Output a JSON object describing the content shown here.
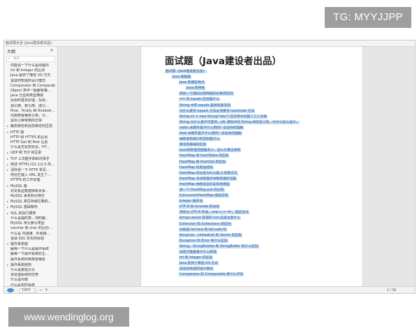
{
  "watermarks": {
    "top": "TG: MYYJJPP",
    "bottom": "www.wendinglog.org"
  },
  "window": {
    "title": "面试题大全 (Java建设者出品)"
  },
  "sidebar": {
    "title": "大纲",
    "add_icon": "plus-icon",
    "search_placeholder": "搜索",
    "items": [
      {
        "label": "你能说一下什么是线程吗",
        "arrow": ""
      },
      {
        "label": "int 和 Integer 的区别",
        "arrow": ""
      },
      {
        "label": "Java 提供了哪些 I/O 方式",
        "arrow": ""
      },
      {
        "label": "谈谈你知道的设计模式",
        "arrow": ""
      },
      {
        "label": "Comparator 和 Comparab",
        "arrow": ""
      },
      {
        "label": "Object 类中一般都有哪…",
        "arrow": ""
      },
      {
        "label": "Java 泛型和类型擦除",
        "arrow": ""
      },
      {
        "label": "反射的基本原理，反射…",
        "arrow": ""
      },
      {
        "label": "强引用、若引用、虚引…",
        "arrow": ""
      },
      {
        "label": "final、finally 和 finalize(…",
        "arrow": ""
      },
      {
        "label": "内部类有哪些分类，分…",
        "arrow": ""
      },
      {
        "label": "说出几种常用的异常",
        "arrow": ""
      },
      {
        "label": "静态绑定和动态绑定的区别",
        "arrow": "▸"
      },
      {
        "label": "HTTP 篇",
        "arrow": "▾"
      },
      {
        "label": "HTTP 和 HTTPS 的区别",
        "arrow": ""
      },
      {
        "label": "HTTP Get 和 Post 区别",
        "arrow": ""
      },
      {
        "label": "什么是无状态协议，HT…",
        "arrow": ""
      },
      {
        "label": "UDP 和 TCP 的区别",
        "arrow": "▸"
      },
      {
        "label": "TCP 三次握手和四次挥手",
        "arrow": "▸"
      },
      {
        "label": "简述 HTTP1.0/1.1/2.0 的…",
        "arrow": "▸"
      },
      {
        "label": "请你说一下 HTTP 常见…",
        "arrow": "▸"
      },
      {
        "label": "地址栏输入 URL 发生了…",
        "arrow": ""
      },
      {
        "label": "HTTPS 的工作原理",
        "arrow": ""
      },
      {
        "label": "MySQL 篇",
        "arrow": "▾"
      },
      {
        "label": "非关系型数据库和关系…",
        "arrow": ""
      },
      {
        "label": "MySQL 事务四大特性",
        "arrow": ""
      },
      {
        "label": "MySQL 常见存储引擎的…",
        "arrow": "▸"
      },
      {
        "label": "MySQL 基础架构",
        "arrow": "▸"
      },
      {
        "label": "SQL 的执行顺序",
        "arrow": "▸"
      },
      {
        "label": "什么是临时表，何时删…",
        "arrow": ""
      },
      {
        "label": "MySQL 常见索引类型",
        "arrow": ""
      },
      {
        "label": "varchar 和 char 的区别…",
        "arrow": ""
      },
      {
        "label": "什么是 内连接、外连接…",
        "arrow": ""
      },
      {
        "label": "谈谈 SQL 优化的经验",
        "arrow": ""
      },
      {
        "label": "操作系统篇",
        "arrow": "▾"
      },
      {
        "label": "解释一下什么是操作系统",
        "arrow": ""
      },
      {
        "label": "解释一下操作系统的主…",
        "arrow": ""
      },
      {
        "label": "操作系统的种类有哪些",
        "arrow": ""
      },
      {
        "label": "操作系统结构",
        "arrow": "▸"
      },
      {
        "label": "什么是按需分页",
        "arrow": ""
      },
      {
        "label": "多处理系统的优势",
        "arrow": ""
      },
      {
        "label": "什么是内核",
        "arrow": ""
      },
      {
        "label": "什么是实时系统",
        "arrow": ""
      }
    ]
  },
  "document": {
    "title": "面试题（Java建设者出品）",
    "lines": [
      {
        "text": "面试题（Java建设者出品）",
        "indent": 0
      },
      {
        "text": "Java 基础篇",
        "indent": 1
      },
      {
        "text": "Java 有哪些特点",
        "indent": 2
      },
      {
        "text": "Java 的特性",
        "indent": 3
      },
      {
        "text": "简述一下面向过程和面向对象的区别",
        "indent": 2
      },
      {
        "text": "== 和 equals 区别是什么",
        "indent": 2
      },
      {
        "text": "String 中的 equals 是如何重写的",
        "indent": 2
      },
      {
        "text": "为什么重写 equals 方法必须重写 hashcode 方法",
        "indent": 2
      },
      {
        "text": "String s1 = new String(\"abc\") 在内存中创建了几个对象",
        "indent": 2
      },
      {
        "text": "String 为什么是不可变的、jdk 源码中的 String 如何定义的、为什么这么设计。",
        "indent": 2
      },
      {
        "text": "static 关键字是干什么用的？谈谈你的理解",
        "indent": 2
      },
      {
        "text": "final 关键字是干什么用的？谈谈你的理解",
        "indent": 2
      },
      {
        "text": "抽象类和接口的区别是什么",
        "indent": 2
      },
      {
        "text": "重写和重载的区别",
        "indent": 2
      },
      {
        "text": "byte的取值范围是多少，怎么计算出来的",
        "indent": 2
      },
      {
        "text": "HashMap 和 HashTable 的区别",
        "indent": 2
      },
      {
        "text": "HashMap 和 HashSet 的区别",
        "indent": 2
      },
      {
        "text": "HashMap 的底层结构",
        "indent": 2
      },
      {
        "text": "HashMap 的长度为什么是 2 的幂次方",
        "indent": 2
      },
      {
        "text": "HashMap 多线程操作导致死循环问题",
        "indent": 2
      },
      {
        "text": "HashMap 线程安全的实现有哪些",
        "indent": 2
      },
      {
        "text": "讲一下 HashMap put 的过程",
        "indent": 2
      },
      {
        "text": "ConcurrentHashMap 底层实现",
        "indent": 2
      },
      {
        "text": "Integer 缓存池",
        "indent": 2
      },
      {
        "text": "UTF-8 和 Unicode 的关系",
        "indent": 2
      },
      {
        "text": "项目为 UTF-8 环境，char c = '中'，是否合法",
        "indent": 2
      },
      {
        "text": "Arrays.asList 获得的 List 应该注意什么",
        "indent": 2
      },
      {
        "text": "Collection 和 Collections 的区别",
        "indent": 2
      },
      {
        "text": "你知道 fail-fast 和 fail-safe 吗",
        "indent": 2
      },
      {
        "text": "ArrayList、LinkedList 和 Vector 的区别",
        "indent": 2
      },
      {
        "text": "Exception 和 Error 有什么区别",
        "indent": 2
      },
      {
        "text": "String、StringBuilder 和 StringBuffer 有什么区别",
        "indent": 2
      },
      {
        "text": "动态代理是基于什么原理",
        "indent": 2
      },
      {
        "text": "int 和 Integer 的区别",
        "indent": 2
      },
      {
        "text": "Java 提供了哪些 I/O 方式",
        "indent": 2
      },
      {
        "text": "谈谈你知道的设计模式",
        "indent": 2
      },
      {
        "text": "Comparator 和 Comparable 有什么不同",
        "indent": 2
      }
    ]
  },
  "statusbar": {
    "zoom": "100%",
    "zoom_out": "−",
    "zoom_in": "+",
    "page_current": "1",
    "page_total": "/ 78"
  }
}
